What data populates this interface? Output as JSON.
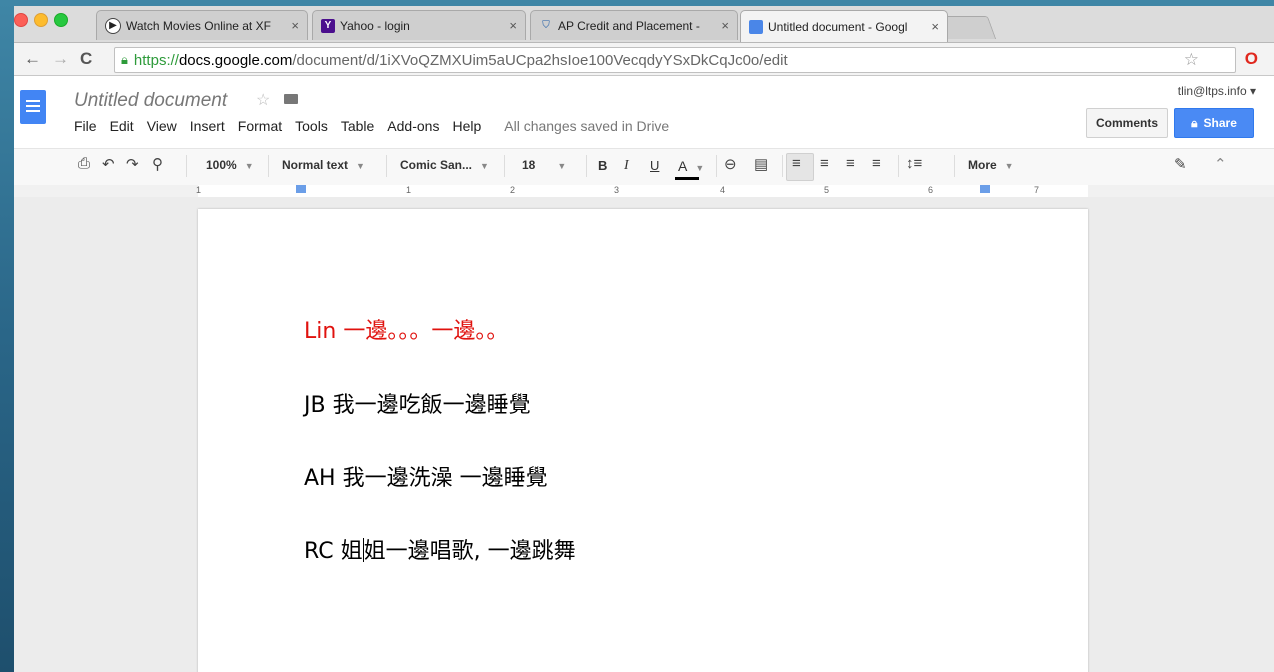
{
  "browser": {
    "tabs": [
      {
        "title": "Watch Movies Online at XF",
        "icon": "play-icon",
        "active": false
      },
      {
        "title": "Yahoo - login",
        "icon": "yahoo-icon",
        "active": false
      },
      {
        "title": "AP Credit and Placement -",
        "icon": "shield-icon",
        "active": false
      },
      {
        "title": "Untitled document - Googl",
        "icon": "docs-icon",
        "active": true
      }
    ],
    "close_glyph": "×",
    "url": {
      "scheme": "https://",
      "host": "docs.google.com",
      "path": "/document/d/1iXVoQZMXUim5aUCpa2hsIoe100VecqdyYSxDkCqJc0o/edit"
    }
  },
  "docs": {
    "title": "Untitled document",
    "user": "tlin@ltps.info",
    "menu": [
      "File",
      "Edit",
      "View",
      "Insert",
      "Format",
      "Tools",
      "Table",
      "Add-ons",
      "Help"
    ],
    "save_status": "All changes saved in Drive",
    "comments_label": "Comments",
    "share_label": "Share",
    "accent_color": "#4285f4"
  },
  "toolbar": {
    "zoom": "100%",
    "style": "Normal text",
    "font": "Comic San...",
    "size": "18",
    "bold": "B",
    "italic": "I",
    "underline": "U",
    "text_color": "A",
    "more": "More"
  },
  "ruler": {
    "labels": [
      "1",
      "1",
      "2",
      "3",
      "4",
      "5",
      "6",
      "7"
    ]
  },
  "document": {
    "lines": [
      {
        "speaker": "Lin",
        "text": "一邊。。。一邊。。",
        "color": "#e0120e"
      },
      {
        "speaker": "JB",
        "text": "我一邊吃飯一邊睡覺",
        "color": "#000000"
      },
      {
        "speaker": "AH",
        "text": "我一邊洗澡 一邊睡覺",
        "color": "#000000"
      },
      {
        "speaker": "RC",
        "text_before_cursor": "姐",
        "text_after_cursor": "姐一邊唱歌, 一邊跳舞",
        "color": "#000000"
      }
    ]
  }
}
